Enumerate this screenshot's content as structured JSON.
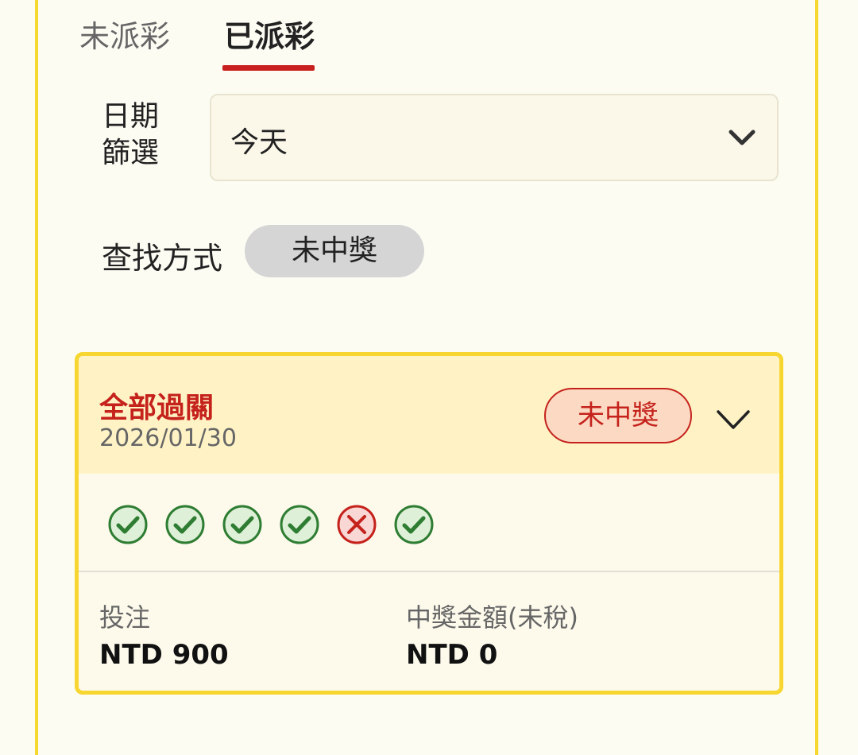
{
  "tabs": [
    {
      "label": "未派彩",
      "active": false
    },
    {
      "label": "已派彩",
      "active": true
    }
  ],
  "date_filter": {
    "label": "日期\n篩選",
    "value": "今天"
  },
  "search_method": {
    "label": "查找方式",
    "filter": "未中獎"
  },
  "bet_card": {
    "title": "全部過關",
    "date": "2026/01/30",
    "result": "未中獎",
    "legs": [
      "win",
      "win",
      "win",
      "win",
      "lose",
      "win"
    ],
    "stake_label": "投注",
    "stake_value": "NTD 900",
    "payout_label": "中獎金額(未稅)",
    "payout_value": "NTD 0"
  },
  "colors": {
    "accent": "#c8201f",
    "border": "#f5d830",
    "win": "#2e7d32",
    "lose": "#c5221c"
  }
}
